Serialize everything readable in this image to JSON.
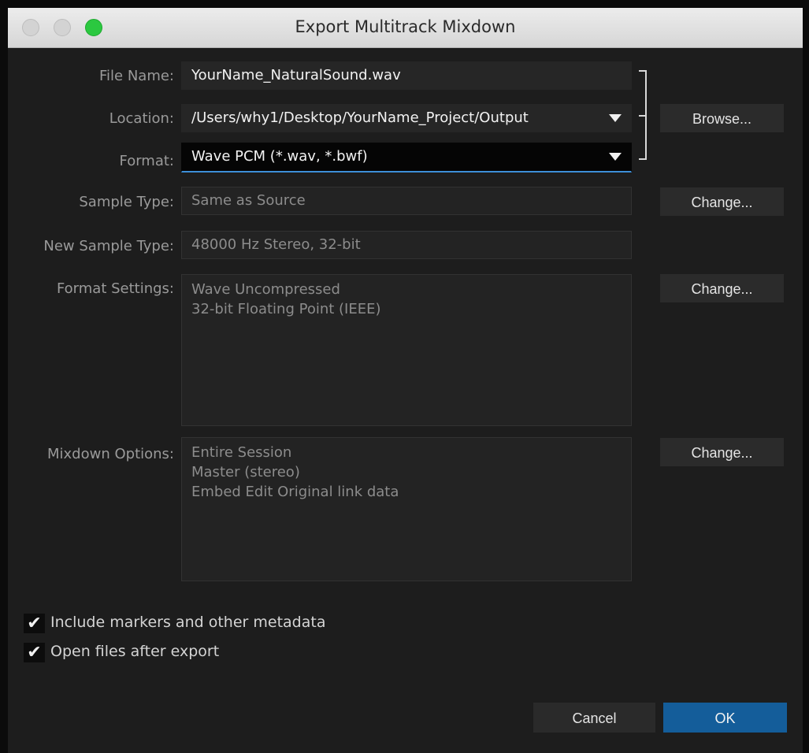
{
  "window": {
    "title": "Export Multitrack Mixdown"
  },
  "form": {
    "file_name": {
      "label": "File Name:",
      "value": "YourName_NaturalSound.wav"
    },
    "location": {
      "label": "Location:",
      "value": "/Users/why1/Desktop/YourName_Project/Output"
    },
    "format": {
      "label": "Format:",
      "value": "Wave PCM (*.wav, *.bwf)"
    },
    "sample_type": {
      "label": "Sample Type:",
      "value": "Same as Source"
    },
    "new_sample_type": {
      "label": "New Sample Type:",
      "value": "48000 Hz Stereo, 32-bit"
    },
    "format_settings": {
      "label": "Format Settings:",
      "lines": [
        "Wave Uncompressed",
        "32-bit Floating Point (IEEE)"
      ]
    },
    "mixdown_options": {
      "label": "Mixdown Options:",
      "lines": [
        "Entire Session",
        "Master (stereo)",
        "Embed Edit Original link data"
      ]
    }
  },
  "buttons": {
    "browse": "Browse...",
    "change_sample_type": "Change...",
    "change_format_settings": "Change...",
    "change_mixdown_options": "Change...",
    "cancel": "Cancel",
    "ok": "OK"
  },
  "checkboxes": {
    "include_markers": {
      "label": "Include markers and other metadata",
      "checked": true,
      "mark": "✔"
    },
    "open_files": {
      "label": "Open files after export",
      "checked": true,
      "mark": "✔"
    }
  },
  "icons": {
    "dropdown_caret": "chevron-down-icon",
    "checkmark": "checkmark-icon"
  },
  "colors": {
    "accent": "#145d9a",
    "focus_underline": "#3d8fd8",
    "zoom_light": "#2bc840",
    "panel_bg": "#1d1d1d"
  }
}
